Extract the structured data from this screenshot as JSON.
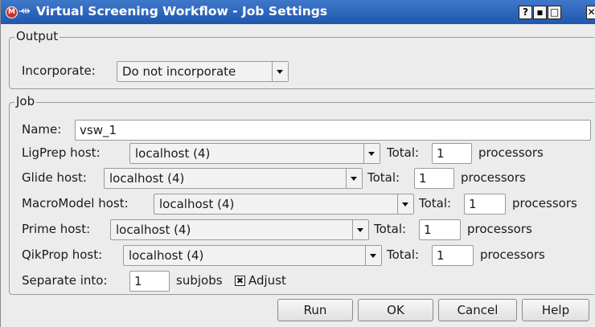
{
  "window": {
    "title": "Virtual Screening Workflow - Job Settings",
    "app_icon_text": "M",
    "pin_glyph": "-⇹",
    "buttons": {
      "help": "?",
      "minimize": "▪",
      "maximize": "□",
      "close": "✕"
    }
  },
  "output": {
    "group_label": "Output",
    "incorporate_label": "Incorporate:",
    "incorporate_value": "Do not incorporate"
  },
  "job": {
    "group_label": "Job",
    "name_label": "Name:",
    "name_value": "vsw_1",
    "total_label": "Total:",
    "processors_label": "processors",
    "hosts": [
      {
        "label": "LigPrep host:",
        "value": "localhost (4)",
        "total": "1"
      },
      {
        "label": "Glide host:",
        "value": "localhost (4)",
        "total": "1"
      },
      {
        "label": "MacroModel host:",
        "value": "localhost (4)",
        "total": "1"
      },
      {
        "label": "Prime host:",
        "value": "localhost (4)",
        "total": "1"
      },
      {
        "label": "QikProp host:",
        "value": "localhost (4)",
        "total": "1"
      }
    ],
    "separate_label": "Separate into:",
    "subjobs_value": "1",
    "subjobs_label": "subjobs",
    "adjust_label": "Adjust",
    "adjust_checked": true,
    "adjust_mark": "✖"
  },
  "footer": {
    "run": "Run",
    "ok": "OK",
    "cancel": "Cancel",
    "help": "Help"
  }
}
